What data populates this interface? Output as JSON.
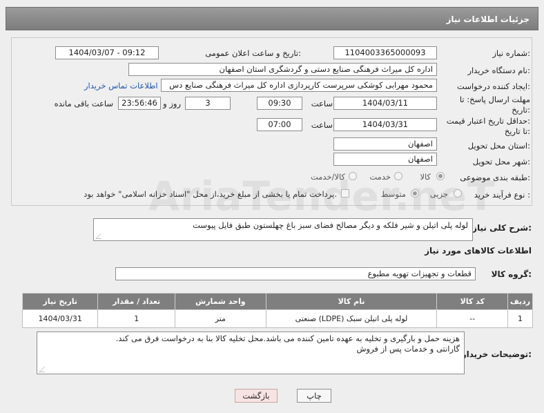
{
  "header": {
    "title": "جزئیات اطلاعات نیاز"
  },
  "labels": {
    "need_number": "شماره نیاز:",
    "public_announce_datetime": "تاریخ و ساعت اعلان عمومی:",
    "buyer_org": "نام دستگاه خریدار:",
    "requester": "ایجاد کننده درخواست:",
    "reply_deadline_1": "مهلت ارسال پاسخ: تا",
    "reply_deadline_2": "تاریخ:",
    "time": "ساعت",
    "day_and": "روز و",
    "remaining": "ساعت باقی مانده",
    "price_validity_1": "حداقل تاریخ اعتبار قیمت:",
    "price_validity_2": "تا تاریخ:",
    "delivery_province": "استان محل تحویل:",
    "delivery_city": "شهر محل تحویل:",
    "category": "طبقه بندی موضوعی:",
    "purchase_process": "نوع فرآیند خرید :",
    "general_description": "شرح کلی نیاز:",
    "goods_info_title": "اطلاعات کالاهای مورد نیاز",
    "goods_group": "گروه کالا:",
    "buyer_notes": "توضیحات خریدار:"
  },
  "values": {
    "need_number": "1104003365000093",
    "public_announce_datetime": "1404/03/07 - 09:12",
    "buyer_org": "اداره کل میراث فرهنگی  صنایع دستی و گردشگری استان اصفهان",
    "requester": "محمود مهرابی کوشکی سرپرست کارپردازی اداره کل میراث فرهنگی  صنایع دس",
    "contact_link": "اطلاعات تماس خریدار",
    "reply_date": "1404/03/11",
    "reply_time": "09:30",
    "reply_days": "3",
    "remaining_time": "23:56:46",
    "validity_date": "1404/03/31",
    "validity_time": "07:00",
    "delivery_province": "اصفهان",
    "delivery_city": "اصفهان",
    "general_description": "لوله پلی اتیلن و شیر فلکه و دیگر مصالح فضای سبز باغ چهلستون طبق فایل پیوست",
    "goods_group": "قطعات و تجهیزات تهویه مطبوع",
    "buyer_notes_line1": "هزینه حمل و بارگیری و تخلیه به عهده تامین کننده می باشد.محل تخلیه کالا بنا به درخواست فرق می کند.",
    "buyer_notes_line2": "گارانتی و خدمات پس از فروش"
  },
  "category_options": {
    "goods": "کالا",
    "service": "خدمت",
    "goods_service": "کالا/خدمت",
    "selected": "goods"
  },
  "process_options": {
    "minor": "جزیی",
    "medium": "متوسط",
    "payment_note": "پرداخت تمام یا بخشی از مبلغ خرید،از محل \"اسناد خزانه اسلامی\" خواهد بود.",
    "selected": "medium"
  },
  "table": {
    "headers": [
      "ردیف",
      "کد کالا",
      "نام کالا",
      "واحد شمارش",
      "تعداد / مقدار",
      "تاریخ نیاز"
    ],
    "rows": [
      [
        "1",
        "--",
        "لوله پلی اتیلن سبک (LDPE) صنعتی",
        "متر",
        "1",
        "1404/03/31"
      ]
    ]
  },
  "buttons": {
    "print": "چاپ",
    "back": "بازگشت"
  },
  "watermark": "AriaTender.neT"
}
